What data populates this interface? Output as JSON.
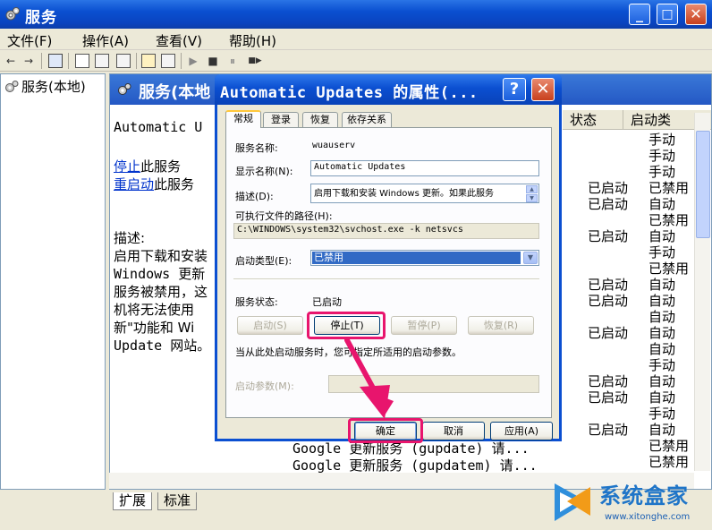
{
  "window": {
    "title": "服务",
    "min": "_",
    "max": "□",
    "close": "✕"
  },
  "menu": [
    "文件(F)",
    "操作(A)",
    "查看(V)",
    "帮助(H)"
  ],
  "toolbar": {
    "back": "←",
    "forward": "→",
    "play": "▶",
    "stop": "■",
    "pause": "⏸",
    "restart": "■▶"
  },
  "tree": {
    "root": "服务(本地)"
  },
  "pane": {
    "header": "服务(本地",
    "service_name": "Automatic U",
    "stop_link": "停止",
    "stop_suffix": "此服务",
    "restart_link": "重启动",
    "restart_suffix": "此服务",
    "desc_label": "描述:",
    "desc_lines": [
      "启用下载和安装",
      "Windows 更新",
      "服务被禁用，这",
      "机将无法使用",
      "新\"功能和 Wi",
      "Update 网站。"
    ]
  },
  "columns": [
    "状态",
    "启动类"
  ],
  "rows": [
    {
      "status": "",
      "startup": "手动"
    },
    {
      "status": "",
      "startup": "手动"
    },
    {
      "status": "",
      "startup": "手动"
    },
    {
      "status": "已启动",
      "startup": "已禁用"
    },
    {
      "status": "已启动",
      "startup": "自动"
    },
    {
      "status": "",
      "startup": "已禁用"
    },
    {
      "status": "已启动",
      "startup": "自动"
    },
    {
      "status": "",
      "startup": "手动"
    },
    {
      "status": "",
      "startup": "已禁用"
    },
    {
      "status": "已启动",
      "startup": "自动"
    },
    {
      "status": "已启动",
      "startup": "自动"
    },
    {
      "status": "",
      "startup": "自动"
    },
    {
      "status": "已启动",
      "startup": "自动"
    },
    {
      "status": "",
      "startup": "自动"
    },
    {
      "status": "",
      "startup": "手动"
    },
    {
      "status": "已启动",
      "startup": "自动"
    },
    {
      "status": "已启动",
      "startup": "自动"
    },
    {
      "status": "",
      "startup": "手动"
    },
    {
      "status": "已启动",
      "startup": "自动"
    },
    {
      "status": "",
      "startup": "已禁用"
    },
    {
      "status": "",
      "startup": "已禁用"
    }
  ],
  "tail_rows": [
    "Google 更新服务 (gupdate)  请...",
    "Google 更新服务 (gupdatem) 请..."
  ],
  "bottom_tabs": [
    "扩展",
    "标准"
  ],
  "dialog": {
    "title": "Automatic Updates 的属性(...",
    "help": "?",
    "close": "✕",
    "tabs": [
      "常规",
      "登录",
      "恢复",
      "依存关系"
    ],
    "service_name_label": "服务名称:",
    "service_name_value": "wuauserv",
    "display_name_label": "显示名称(N):",
    "display_name_value": "Automatic Updates",
    "desc_label": "描述(D):",
    "desc_value": "启用下载和安装 Windows 更新。如果此服务",
    "path_label": "可执行文件的路径(H):",
    "path_value": "C:\\WINDOWS\\system32\\svchost.exe -k netsvcs",
    "startup_label": "启动类型(E):",
    "startup_value": "已禁用",
    "status_label": "服务状态:",
    "status_value": "已启动",
    "btn_start": "启动(S)",
    "btn_stop": "停止(T)",
    "btn_pause": "暂停(P)",
    "btn_resume": "恢复(R)",
    "hint": "当从此处启动服务时，您可指定所适用的启动参数。",
    "params_label": "启动参数(M):",
    "params_value": "",
    "ok": "确定",
    "cancel": "取消",
    "apply": "应用(A)"
  },
  "watermark": {
    "text": "系统盒家",
    "url": "www.xitonghe.com"
  },
  "colors": {
    "xp_blue": "#0b4fd1",
    "highlight": "#e8156d",
    "selection": "#316ac5"
  }
}
